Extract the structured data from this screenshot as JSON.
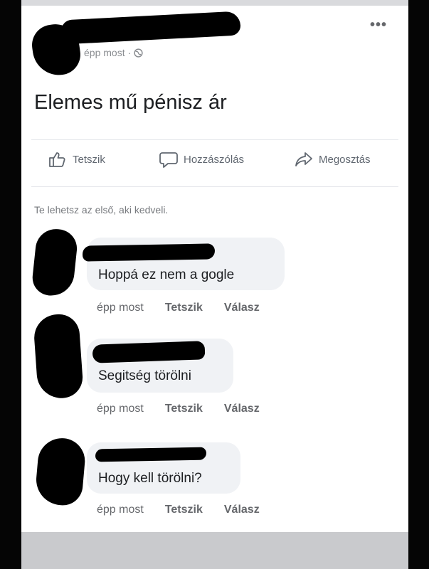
{
  "post": {
    "timestamp": "épp most",
    "separator": "·",
    "text": "Elemes mű pénisz ár",
    "more": "•••"
  },
  "actions": {
    "like": "Tetszik",
    "comment": "Hozzászólás",
    "share": "Megosztás"
  },
  "first_like_text": "Te lehetsz az első, aki kedveli.",
  "comments": [
    {
      "text": "Hoppá ez nem a gogle",
      "time": "épp most",
      "like": "Tetszik",
      "reply": "Válasz"
    },
    {
      "text": "Segitség törölni",
      "time": "épp most",
      "like": "Tetszik",
      "reply": "Válasz"
    },
    {
      "text": "Hogy kell törölni?",
      "time": "épp most",
      "like": "Tetszik",
      "reply": "Válasz"
    }
  ]
}
